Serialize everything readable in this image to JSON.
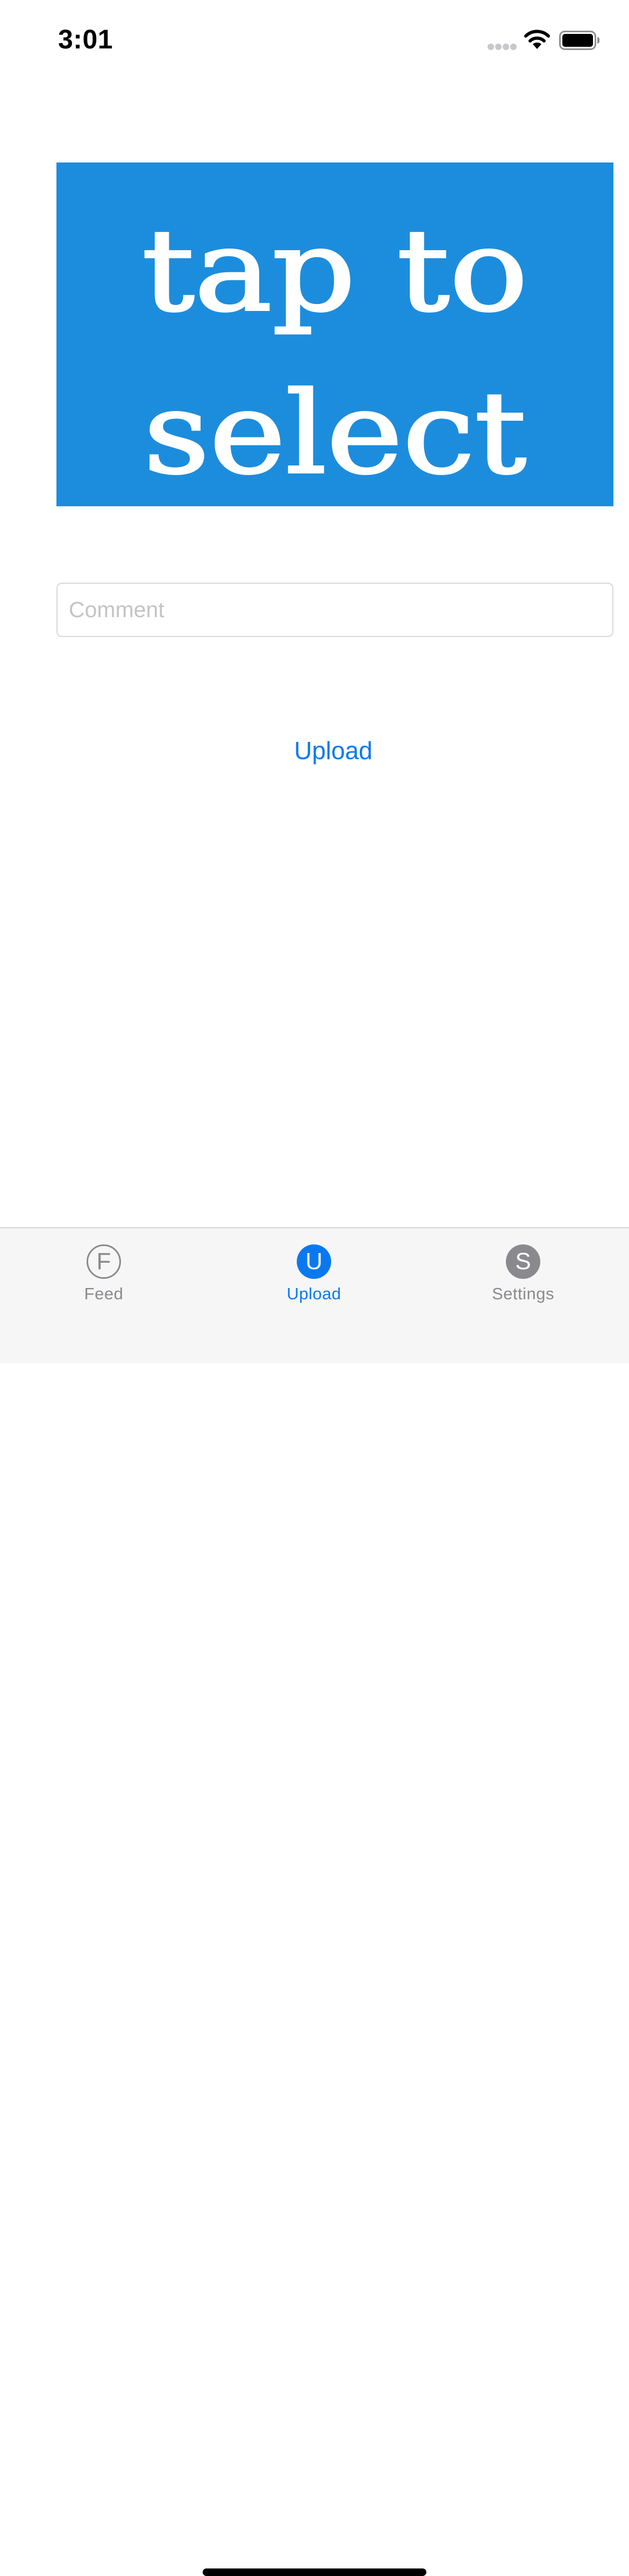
{
  "status_bar": {
    "time": "3:01"
  },
  "image_picker": {
    "line1": "tap to",
    "line2": "select",
    "background_color": "#1c8ddd"
  },
  "comment": {
    "value": "",
    "placeholder": "Comment"
  },
  "upload_button": {
    "label": "Upload"
  },
  "tab_bar": {
    "selected": "Upload",
    "tabs": [
      {
        "label": "Feed",
        "icon_letter": "F",
        "icon": "f-circle-outline-icon",
        "active": false
      },
      {
        "label": "Upload",
        "icon_letter": "U",
        "icon": "u-circle-filled-icon",
        "active": true
      },
      {
        "label": "Settings",
        "icon_letter": "S",
        "icon": "s-circle-filled-icon",
        "active": false
      }
    ]
  },
  "colors": {
    "accent": "#0a79f0",
    "inactive": "#8a8a8e",
    "tab_bar_background": "#f6f6f6"
  }
}
